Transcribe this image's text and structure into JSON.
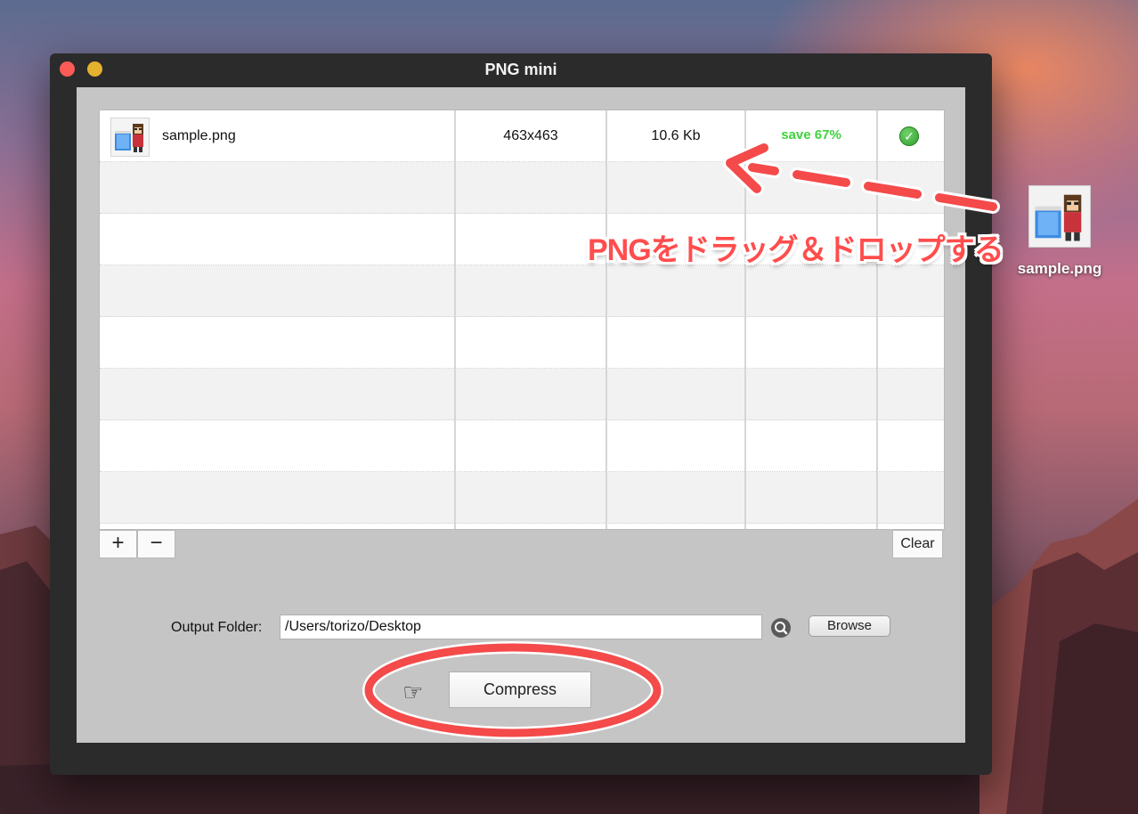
{
  "window": {
    "title": "PNG mini"
  },
  "table": {
    "rows": [
      {
        "filename": "sample.png",
        "dimensions": "463x463",
        "size": "10.6 Kb",
        "savings": "save 67%",
        "status": "done"
      }
    ]
  },
  "toolbar": {
    "add_label": "+",
    "remove_label": "−",
    "clear_label": "Clear"
  },
  "output": {
    "label": "Output Folder:",
    "path": "/Users/torizo/Desktop",
    "browse_label": "Browse"
  },
  "compress": {
    "label": "Compress"
  },
  "annotation": {
    "text": "PNGをドラッグ＆ドロップする",
    "color": "#ff4d4d"
  },
  "desktop": {
    "file_label": "sample.png"
  },
  "colors": {
    "savings_green": "#3fd23c",
    "check_green": "#2f9a2c",
    "close_red": "#fc5b57",
    "minimize_yellow": "#e5b22f"
  },
  "icons": {
    "file_thumbnail": "pixel-art-character-thumbnail-icon",
    "status": "checkmark-circle-icon",
    "search": "magnifier-icon",
    "compress_hint": "pointing-hand-icon"
  }
}
